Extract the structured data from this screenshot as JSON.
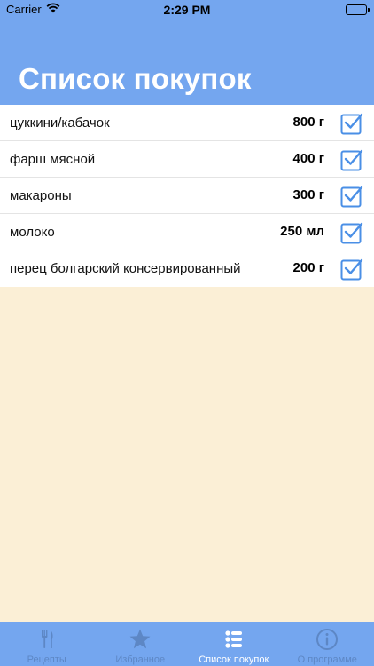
{
  "status_bar": {
    "carrier": "Carrier",
    "time": "2:29 PM",
    "wifi_icon": "wifi-icon",
    "battery_icon": "battery-icon"
  },
  "header": {
    "title": "Список покупок",
    "background_color": "#74a6ef"
  },
  "shopping_list": {
    "items": [
      {
        "name": "цуккини/кабачок",
        "quantity": "800 г",
        "checked": true
      },
      {
        "name": "фарш мясной",
        "quantity": "400 г",
        "checked": true
      },
      {
        "name": "макароны",
        "quantity": "300 г",
        "checked": true
      },
      {
        "name": "молоко",
        "quantity": "250 мл",
        "checked": true
      },
      {
        "name": "перец болгарский консервированный",
        "quantity": "200 г",
        "checked": true
      }
    ],
    "check_icon": "checkbox-checked-icon",
    "check_color": "#4a8fe6"
  },
  "tab_bar": {
    "tabs": [
      {
        "label": "Рецепты",
        "icon": "fork-knife-icon",
        "active": false
      },
      {
        "label": "Избранное",
        "icon": "star-icon",
        "active": false
      },
      {
        "label": "Список покупок",
        "icon": "list-icon",
        "active": true
      },
      {
        "label": "О программе",
        "icon": "info-icon",
        "active": false
      }
    ],
    "background_color": "#74a6ef"
  },
  "page_background_color": "#fbefd6"
}
